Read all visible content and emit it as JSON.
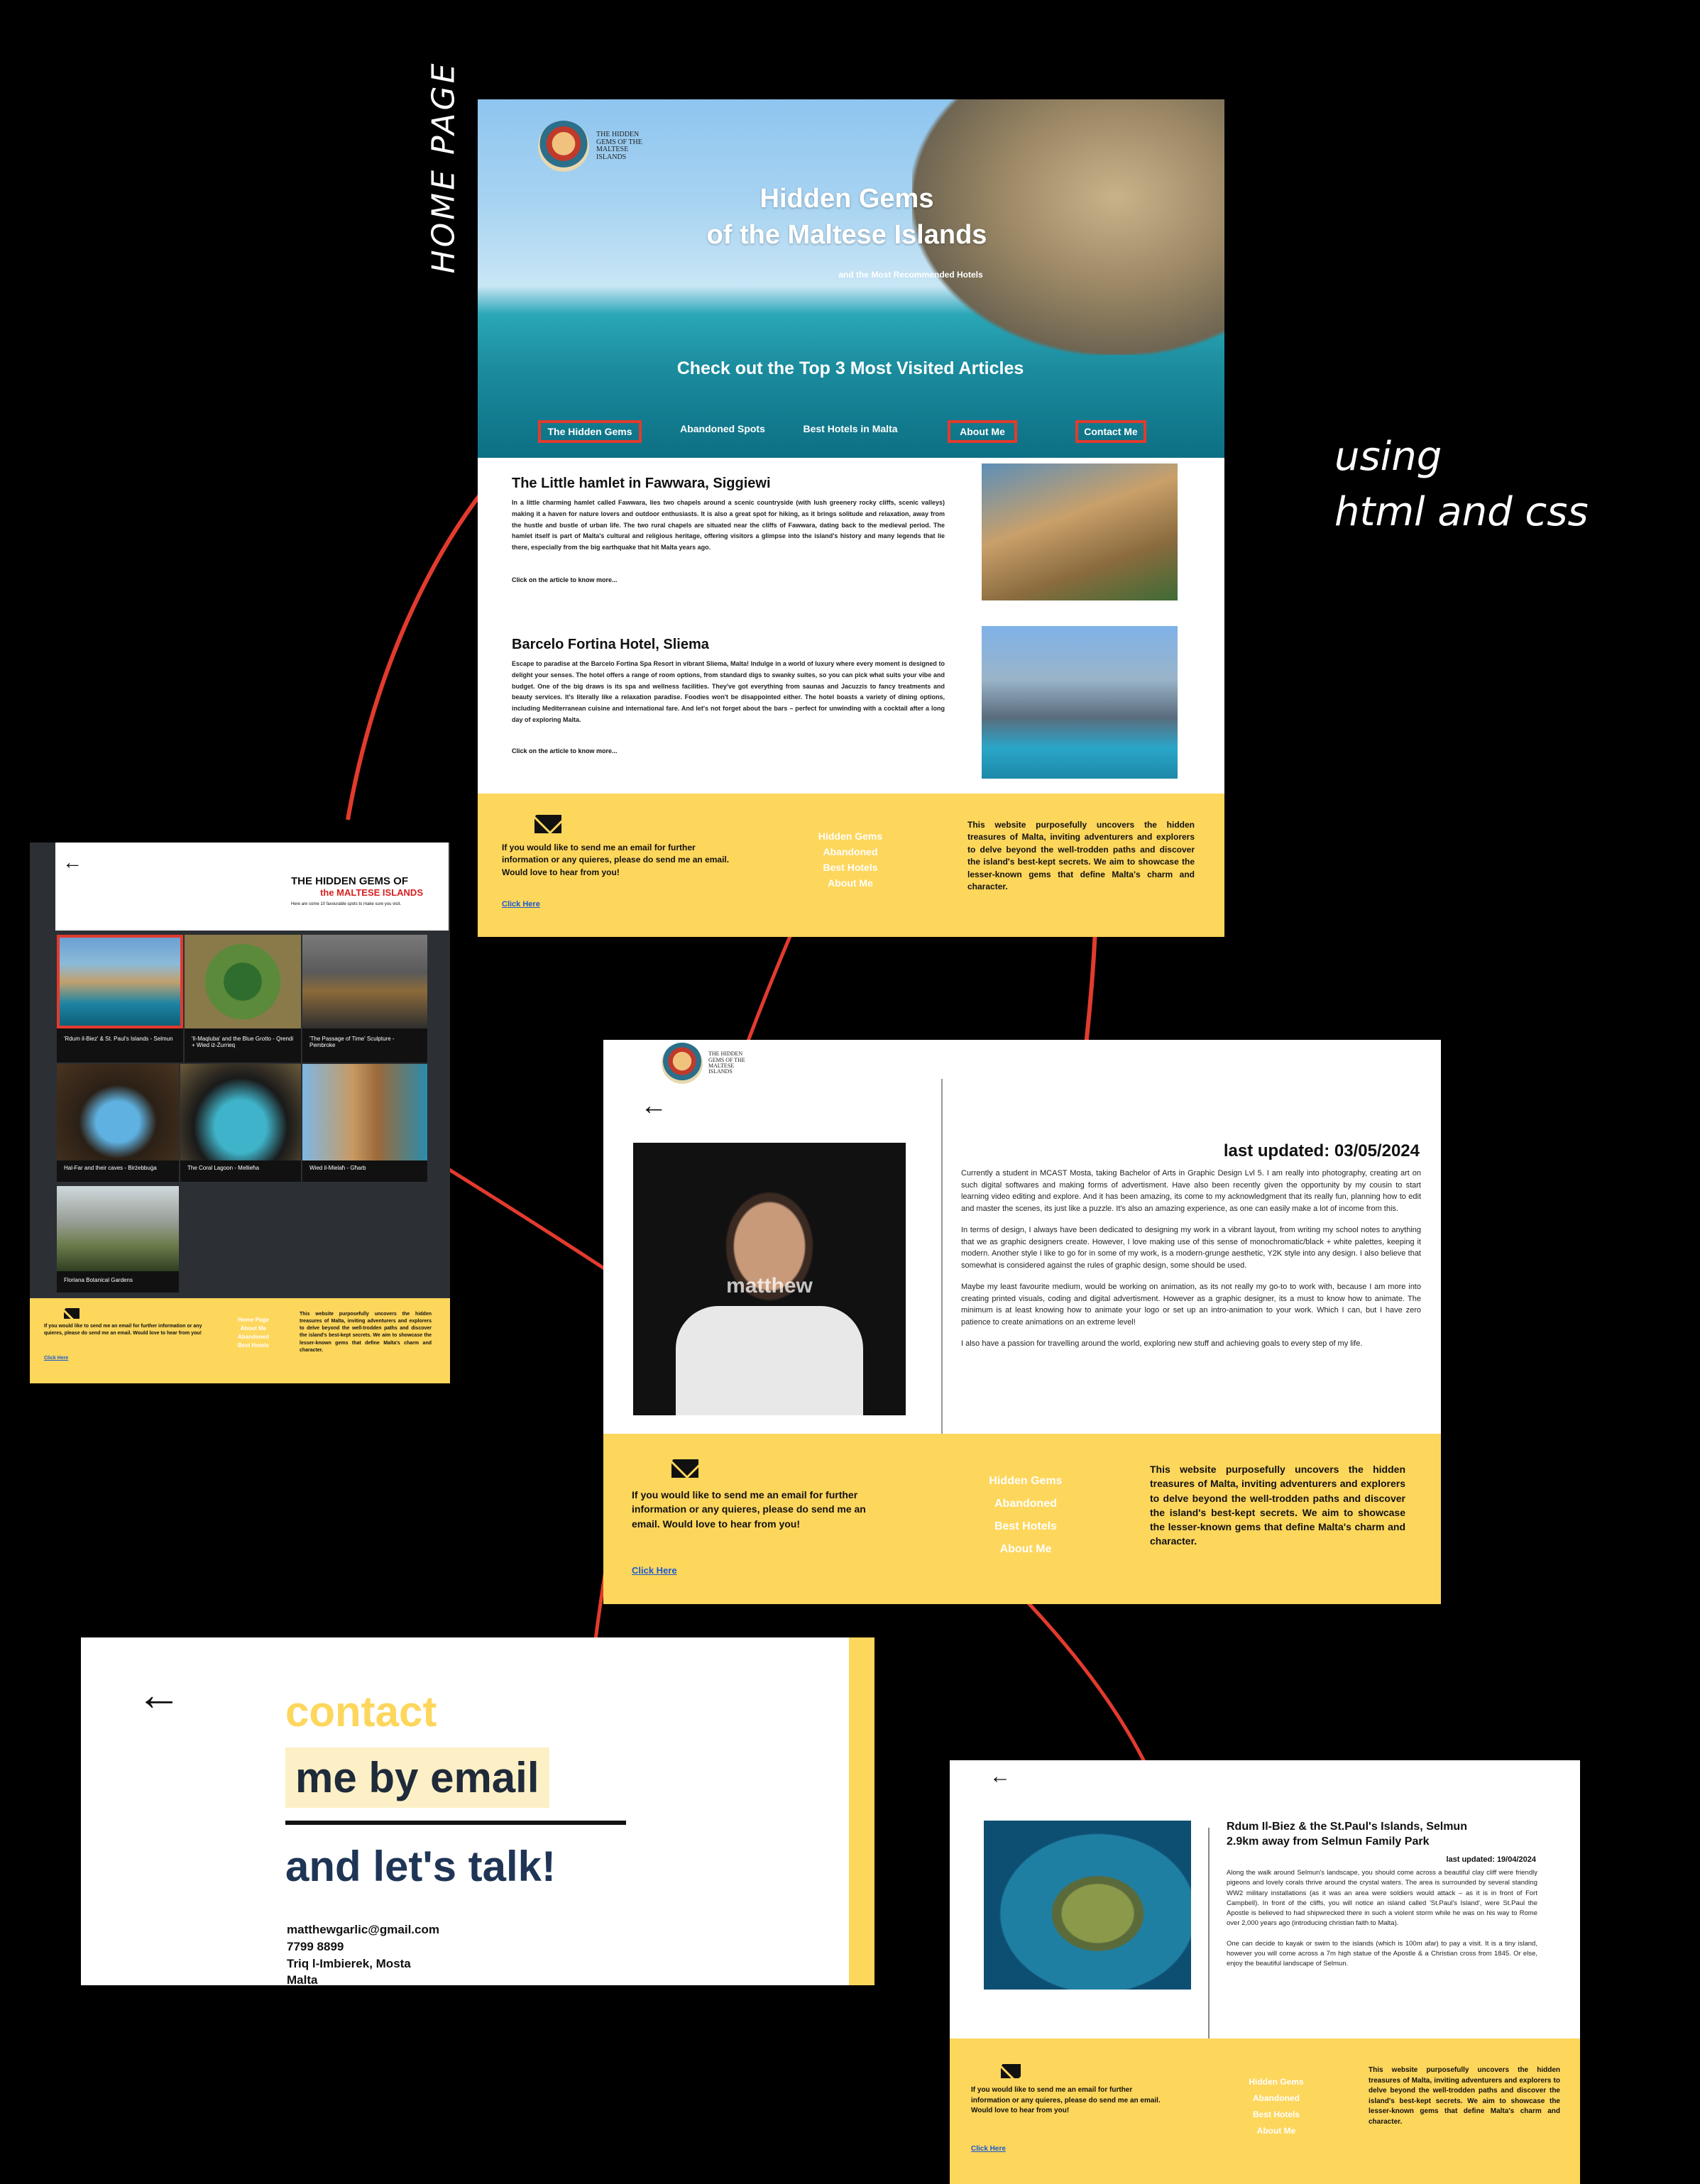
{
  "annotations": {
    "home_page_label": "HOME PAGE",
    "using_line1": "using",
    "using_line2": "html and css"
  },
  "colors": {
    "accent_yellow": "#fdd65c",
    "link_red": "#e23b2e",
    "link_blue": "#1a5bd1",
    "nav_text": "#ffffff"
  },
  "home": {
    "logo_text": [
      "THE HIDDEN",
      "GEMS OF THE",
      "MALTESE",
      "ISLANDS"
    ],
    "hero_title_line1": "Hidden Gems",
    "hero_title_line2": "of the Maltese Islands",
    "hero_subtitle": "and the Most Recommended Hotels",
    "hero_cta": "Check out the Top 3 Most Visited Articles",
    "nav": [
      "The Hidden Gems",
      "Abandoned Spots",
      "Best Hotels in Malta",
      "About Me",
      "Contact Me"
    ],
    "articles": [
      {
        "title": "The Little hamlet in Fawwara, Siggiewi",
        "body": "In a little charming hamlet called Fawwara, lies two chapels around a scenic countryside (with lush greenery rocky cliffs, scenic valleys) making it a haven for nature lovers and outdoor enthusiasts. It is also a great spot for hiking, as it brings solitude and relaxation, away from the hustle and bustle of urban life. The two rural chapels are situated near the cliffs of Fawwara, dating back to the medieval period. The hamlet itself is part of Malta's cultural and religious heritage, offering visitors a glimpse into the island's history and many legends that lie there, especially from the big earthquake that hit Malta years ago.",
        "more": "Click on the article to know more..."
      },
      {
        "title": "Barcelo Fortina Hotel, Sliema",
        "body": "Escape to paradise at the Barcelo Fortina Spa Resort in vibrant Sliema, Malta! Indulge in a world of luxury where every moment is designed to delight your senses. The hotel offers a range of room options, from standard digs to swanky suites, so you can pick what suits your vibe and budget. One of the big draws is its spa and wellness facilities. They've got everything from saunas and Jacuzzis to fancy treatments and beauty services. It's literally like a relaxation paradise. Foodies won't be disappointed either. The hotel boasts a variety of dining options, including Mediterranean cuisine and international fare. And let's not forget about the bars – perfect for unwinding with a cocktail after a long day of exploring Malta.",
        "more": "Click on the article to know more..."
      }
    ]
  },
  "footer": {
    "email_text": "If you would like to send me an email for further information or any quieres, please do send me an email. Would love to hear from you!",
    "click_here": "Click Here",
    "links_home": [
      "Hidden Gems",
      "Abandoned",
      "Best Hotels",
      "About Me"
    ],
    "links_gems": [
      "Home Page",
      "About Me",
      "Abandoned",
      "Best Hotels"
    ],
    "about_text": "This website purposefully uncovers the hidden treasures of Malta, inviting adventurers and explorers to delve beyond the well-trodden paths and discover the island's best-kept secrets. We aim to showcase the lesser-known gems that define Malta's charm and character."
  },
  "gems": {
    "back_arrow": "←",
    "title_line1": "THE HIDDEN GEMS OF",
    "title_line2": "the MALTESE ISLANDS",
    "subtitle": "Here are some 10 favourable spots to make sure you visit.",
    "cards": [
      "'Rdum il-Biez' & St. Paul's Islands - Selmun",
      "'Il-Maqluba' and the Blue Grotto - Qrendi + Wied iż-Żurrieq",
      "'The Passage of Time' Sculpture - Pembroke",
      "Hal-Far and their caves - Birżebbuġa",
      "The Coral Lagoon - Mellieħa",
      "Wied il-Mielaħ - Għarb",
      "Floriana Botanical Gardens"
    ]
  },
  "about": {
    "back_arrow": "←",
    "photo_name": "matthew",
    "updated": "last updated: 03/05/2024",
    "paragraphs": [
      "Currently a student in MCAST Mosta, taking Bachelor of Arts in Graphic Design Lvl 5. I am really into photography, creating art on such digital softwares and making forms of advertisment. Have also been recently given the opportunity by my cousin to start learning video editing and explore. And it has been amazing, its come to my acknowledgment that its really fun, planning how to edit and master the scenes, its just like a puzzle. It's also an amazing experience, as one can easily make a lot of income from this.",
      "In terms of design, I always have been dedicated to designing my work in a vibrant layout, from writing my school notes to anything that we as graphic designers create. However, I love making use of this sense of monochromatic/black + white palettes, keeping it modern. Another style I like to go for in some of my work, is a modern-grunge aesthetic, Y2K style into any design. I also believe that somewhat is considered against the rules of graphic design, some should be used.",
      "Maybe my least favourite medium, would be working on animation, as its not really my go-to to work with, because I am more into creating printed visuals, coding and digital advertisment. However as a graphic designer, its a must to know how to animate. The minimum is at least knowing how to animate your logo or set up an intro-animation to your work. Which I can, but I have zero patience to create animations on an extreme level!",
      "I also have a passion for travelling around the world, exploring new stuff and achieving goals to every step of my life."
    ]
  },
  "contact": {
    "back_arrow": "←",
    "line1": "contact",
    "line2": "me by email",
    "line3": "and let's talk!",
    "email": "matthewgarlic@gmail.com",
    "phone": "7799 8899",
    "address1": "Triq l-Imbierek, Mosta",
    "address2": "Malta"
  },
  "article": {
    "back_arrow": "←",
    "title_line1": "Rdum Il-Biez & the St.Paul's Islands, Selmun",
    "title_line2": "2.9km away from Selmun Family Park",
    "updated": "last updated: 19/04/2024",
    "p1": "Along the walk around Selmun's landscape, you should come across a beautiful clay cliff were friendly pigeons and lovely corals thrive around the crystal waters. The area is surrounded by several standing WW2 military installations (as it was an area were soldiers would attack – as it is in front of Fort Campbell). In front of the cliffs, you will notice an island called 'St.Paul's Island', were St.Paul the Apostle is believed to had shipwrecked there in such a violent storm while he was on his way to Rome over 2,000 years ago (introducing christian faith to Malta).",
    "p2": "One can decide to kayak or swim to the islands (which is 100m afar) to pay a visit. It is a tiny island, however you will come across a 7m high statue of the Apostle & a Christian cross from 1845. Or else, enjoy the beautiful landscape of Selmun."
  }
}
